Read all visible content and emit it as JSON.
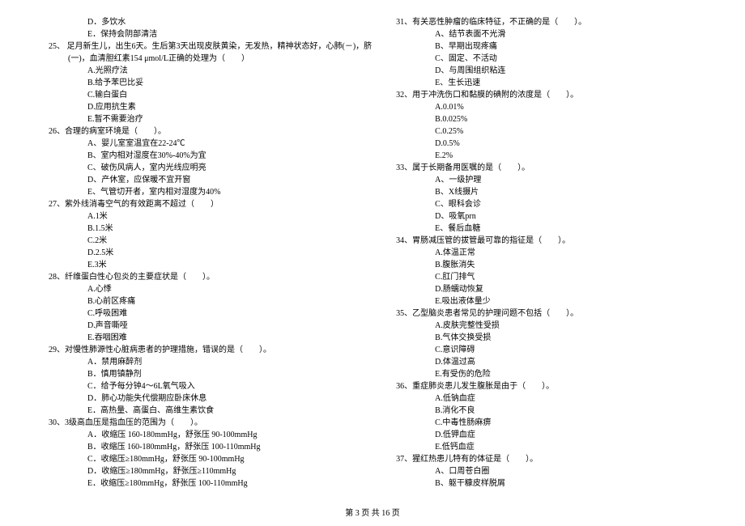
{
  "left_col": [
    {
      "cls": "opt",
      "text": "D．多饮水"
    },
    {
      "cls": "opt",
      "text": "E．保持会阴部清洁"
    },
    {
      "cls": "q",
      "text": "25、 足月新生儿，出生6天。生后第3天出现皮肤黄染，无发热，精神状态好，心肺(－)，脐"
    },
    {
      "cls": "cont",
      "text": "(一)，血清胆红素154 μmol/L正确的处理为（　　）"
    },
    {
      "cls": "opt",
      "text": "A.光照疗法"
    },
    {
      "cls": "opt",
      "text": "B.给予苯巴比妥"
    },
    {
      "cls": "opt",
      "text": "C.输白蛋白"
    },
    {
      "cls": "opt",
      "text": "D.应用抗生素"
    },
    {
      "cls": "opt",
      "text": "E.暂不需要治疗"
    },
    {
      "cls": "q",
      "text": "26、合理的病室环境是（　　）。"
    },
    {
      "cls": "opt",
      "text": "A、婴儿室室温宜在22-24℃"
    },
    {
      "cls": "opt",
      "text": "B、室内相对湿度在30%-40%为宜"
    },
    {
      "cls": "opt",
      "text": "C、破伤风病人，室内光线应明亮"
    },
    {
      "cls": "opt",
      "text": "D、产休室，应保暖不宜开窗"
    },
    {
      "cls": "opt",
      "text": "E、气管切开者，室内相对湿度为40%"
    },
    {
      "cls": "q",
      "text": "27、紫外线消毒空气的有效距离不超过（　　）"
    },
    {
      "cls": "opt",
      "text": "A.1米"
    },
    {
      "cls": "opt",
      "text": "B.1.5米"
    },
    {
      "cls": "opt",
      "text": "C.2米"
    },
    {
      "cls": "opt",
      "text": "D.2.5米"
    },
    {
      "cls": "opt",
      "text": "E.3米"
    },
    {
      "cls": "q",
      "text": "28、纤维蛋白性心包炎的主要症状是（　　）。"
    },
    {
      "cls": "opt",
      "text": "A.心悸"
    },
    {
      "cls": "opt",
      "text": "B.心前区疼痛"
    },
    {
      "cls": "opt",
      "text": "C.呼吸困难"
    },
    {
      "cls": "opt",
      "text": "D.声音嘶哑"
    },
    {
      "cls": "opt",
      "text": "E.吞咽困难"
    },
    {
      "cls": "q",
      "text": "29、对慢性肺源性心脏病患者的护理措施，错误的是（　　）。"
    },
    {
      "cls": "opt",
      "text": "A．禁用麻醉剂"
    },
    {
      "cls": "opt",
      "text": "B．慎用镇静剂"
    },
    {
      "cls": "opt",
      "text": "C．给予每分钟4～6L氧气吸入"
    },
    {
      "cls": "opt",
      "text": "D．肺心功能失代偿期应卧床休息"
    },
    {
      "cls": "opt",
      "text": "E．高热量、高蛋白、高维生素饮食"
    },
    {
      "cls": "q",
      "text": "30、3级高血压是指血压的范围为（　　）。"
    },
    {
      "cls": "opt",
      "text": "A．收缩压 160-180mmHg，舒张压 90-100mmHg"
    },
    {
      "cls": "opt",
      "text": "B．收缩压 160-180mmHg，舒张压 100-110mmHg"
    },
    {
      "cls": "opt",
      "text": "C．收缩压≥180mmHg，舒张压 90-100mmHg"
    },
    {
      "cls": "opt",
      "text": "D．收缩压≥180mmHg，舒张压≥110mmHg"
    },
    {
      "cls": "opt",
      "text": "E．收缩压≥180mmHg，舒张压 100-110mmHg"
    }
  ],
  "right_col": [
    {
      "cls": "q",
      "text": "31、有关恶性肿瘤的临床特征，不正确的是（　　）。"
    },
    {
      "cls": "opt",
      "text": "A、结节表面不光滑"
    },
    {
      "cls": "opt",
      "text": "B、早期出现疼痛"
    },
    {
      "cls": "opt",
      "text": "C、固定、不活动"
    },
    {
      "cls": "opt",
      "text": "D、与周围组织粘连"
    },
    {
      "cls": "opt",
      "text": "E、生长迅速"
    },
    {
      "cls": "q",
      "text": "32、用于冲洗伤口和黏膜的碘附的浓度是（　　）。"
    },
    {
      "cls": "opt",
      "text": "A.0.01%"
    },
    {
      "cls": "opt",
      "text": "B.0.025%"
    },
    {
      "cls": "opt",
      "text": "C.0.25%"
    },
    {
      "cls": "opt",
      "text": "D.0.5%"
    },
    {
      "cls": "opt",
      "text": "E.2%"
    },
    {
      "cls": "q",
      "text": "33、属于长期备用医嘱的是（　　）。"
    },
    {
      "cls": "opt",
      "text": "A、一级护理"
    },
    {
      "cls": "opt",
      "text": "B、X线摄片"
    },
    {
      "cls": "opt",
      "text": "C、眼科会诊"
    },
    {
      "cls": "opt",
      "text": "D、吸氧prn"
    },
    {
      "cls": "opt",
      "text": "E、餐后血糖"
    },
    {
      "cls": "q",
      "text": "34、胃肠减压管的拔管最可靠的指征是（　　）。"
    },
    {
      "cls": "opt",
      "text": "A.体温正常"
    },
    {
      "cls": "opt",
      "text": "B.腹胀消失"
    },
    {
      "cls": "opt",
      "text": "C.肛门排气"
    },
    {
      "cls": "opt",
      "text": "D.肠蠕动恢复"
    },
    {
      "cls": "opt",
      "text": "E.吸出液体量少"
    },
    {
      "cls": "q",
      "text": "35、乙型脑炎患者常见的护理问题不包括（　　）。"
    },
    {
      "cls": "opt",
      "text": "A.皮肤完整性受损"
    },
    {
      "cls": "opt",
      "text": "B.气体交换受损"
    },
    {
      "cls": "opt",
      "text": "C.意识障碍"
    },
    {
      "cls": "opt",
      "text": "D.体温过高"
    },
    {
      "cls": "opt",
      "text": "E.有受伤的危险"
    },
    {
      "cls": "q",
      "text": "36、重症肺炎患儿发生腹胀是由于（　　）。"
    },
    {
      "cls": "opt",
      "text": "A.低钠血症"
    },
    {
      "cls": "opt",
      "text": "B.消化不良"
    },
    {
      "cls": "opt",
      "text": "C.中毒性肠麻痹"
    },
    {
      "cls": "opt",
      "text": "D.低钾血症"
    },
    {
      "cls": "opt",
      "text": "E.低钙血症"
    },
    {
      "cls": "q",
      "text": "37、猩红热患儿特有的体征是（　　）。"
    },
    {
      "cls": "opt",
      "text": "A、口周苍白圈"
    },
    {
      "cls": "opt",
      "text": "B、躯干糠皮样脱屑"
    }
  ],
  "footer": "第 3 页 共 16 页"
}
